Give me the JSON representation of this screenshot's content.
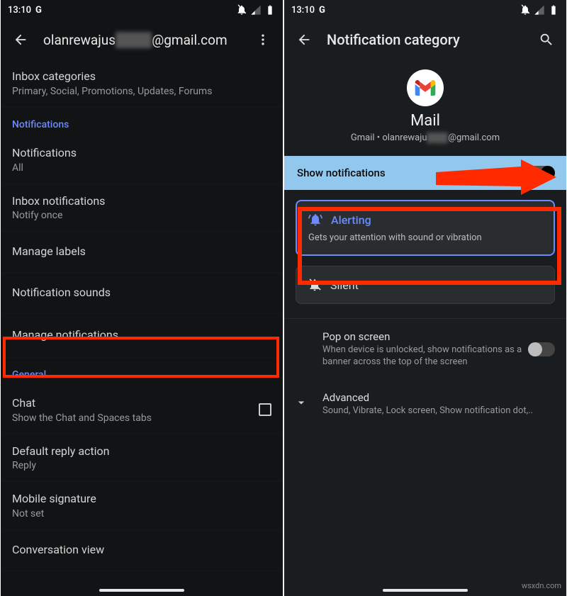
{
  "status": {
    "time": "13:10",
    "g": "G"
  },
  "left": {
    "email_prefix": "olanrewajus",
    "email_suffix": "@gmail.com",
    "sections": {
      "inbox_cat": {
        "title": "Inbox categories",
        "sub": "Primary, Social, Promotions, Updates, Forums"
      },
      "notif_header": "Notifications",
      "notif": {
        "title": "Notifications",
        "sub": "All"
      },
      "inbox_notif": {
        "title": "Inbox notifications",
        "sub": "Notify once"
      },
      "manage_labels": "Manage labels",
      "notif_sounds": "Notification sounds",
      "manage_notif": "Manage notifications",
      "general_header": "General",
      "chat": {
        "title": "Chat",
        "sub": "Show the Chat and Spaces tabs"
      },
      "reply": {
        "title": "Default reply action",
        "sub": "Reply"
      },
      "signature": {
        "title": "Mobile signature",
        "sub": "Not set"
      },
      "conv": "Conversation view"
    }
  },
  "right": {
    "title": "Notification category",
    "app_name": "Mail",
    "sub_prefix": "Gmail • olanrewaju",
    "sub_suffix": "@gmail.com",
    "show_notif": "Show notifications",
    "alerting": {
      "label": "Alerting",
      "desc": "Gets your attention with sound or vibration"
    },
    "silent": "Silent",
    "pop": {
      "title": "Pop on screen",
      "desc": "When device is unlocked, show notifications as a banner across the top of the screen"
    },
    "advanced": {
      "title": "Advanced",
      "desc": "Sound, Vibrate, Lock screen, Show notification dot,.."
    }
  },
  "watermark": "wsxdn.com"
}
